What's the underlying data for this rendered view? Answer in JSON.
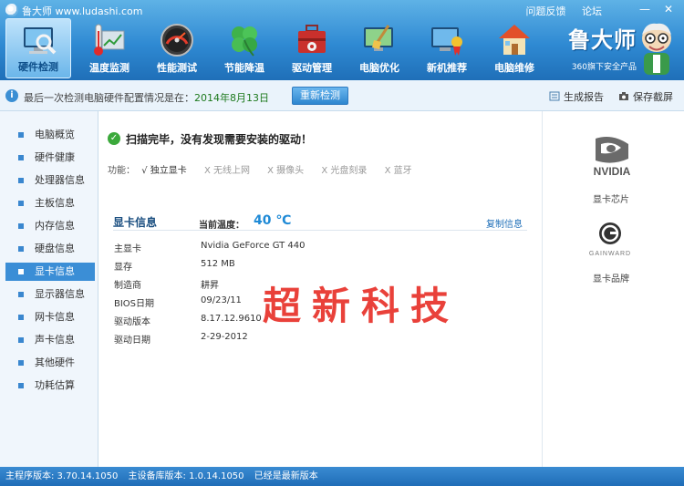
{
  "window": {
    "title": "鲁大师 www.ludashi.com",
    "links": [
      "问题反馈",
      "论坛"
    ],
    "controls": [
      "—",
      "✕"
    ]
  },
  "toolbar": [
    {
      "label": "硬件检测",
      "icon": "monitor-magnifier-icon",
      "active": true
    },
    {
      "label": "温度监测",
      "icon": "thermometer-icon",
      "active": false
    },
    {
      "label": "性能测试",
      "icon": "speedometer-icon",
      "active": false
    },
    {
      "label": "节能降温",
      "icon": "clover-leaf-icon",
      "active": false
    },
    {
      "label": "驱动管理",
      "icon": "toolbox-icon",
      "active": false
    },
    {
      "label": "电脑优化",
      "icon": "monitor-broom-icon",
      "active": false
    },
    {
      "label": "新机推荐",
      "icon": "monitor-award-icon",
      "active": false
    },
    {
      "label": "电脑维修",
      "icon": "house-repair-icon",
      "active": false
    }
  ],
  "brand": {
    "name": "鲁大师",
    "slogan": "360旗下安全产品"
  },
  "infobar": {
    "text": "最后一次检测电脑硬件配置情况是在：",
    "date": "2014年8月13日",
    "rescan": "重新检测",
    "report": "生成报告",
    "screenshot": "保存截屏"
  },
  "sidebar": {
    "items": [
      {
        "label": "电脑概览",
        "active": false
      },
      {
        "label": "硬件健康",
        "active": false
      },
      {
        "label": "处理器信息",
        "active": false
      },
      {
        "label": "主板信息",
        "active": false
      },
      {
        "label": "内存信息",
        "active": false
      },
      {
        "label": "硬盘信息",
        "active": false
      },
      {
        "label": "显卡信息",
        "active": true
      },
      {
        "label": "显示器信息",
        "active": false
      },
      {
        "label": "网卡信息",
        "active": false
      },
      {
        "label": "声卡信息",
        "active": false
      },
      {
        "label": "其他硬件",
        "active": false
      },
      {
        "label": "功耗估算",
        "active": false
      }
    ]
  },
  "main": {
    "scan_message": "扫描完毕，没有发现需要安装的驱动！",
    "functions_label": "功能：",
    "functions": [
      {
        "label": "√ 独立显卡",
        "enabled": true
      },
      {
        "label": "X 无线上网",
        "enabled": false
      },
      {
        "label": "X 摄像头",
        "enabled": false
      },
      {
        "label": "X 光盘刻录",
        "enabled": false
      },
      {
        "label": "X 蓝牙",
        "enabled": false
      }
    ],
    "section_title": "显卡信息",
    "temp_label": "当前温度：",
    "temp_value": "40 ℃",
    "copy_link": "复制信息",
    "rows": [
      {
        "label": "主显卡",
        "value": "Nvidia GeForce GT 440"
      },
      {
        "label": "显存",
        "value": "512 MB"
      },
      {
        "label": "制造商",
        "value": "耕昇"
      },
      {
        "label": "BIOS日期",
        "value": "09/23/11"
      },
      {
        "label": "驱动版本",
        "value": "8.17.12.9610"
      },
      {
        "label": "驱动日期",
        "value": "2-29-2012"
      }
    ],
    "watermark": "超新科技"
  },
  "right_panel": {
    "chip_logo_text": "NVIDIA",
    "chip_label": "显卡芯片",
    "brand_logo_text": "GAINWARD",
    "brand_label": "显卡品牌"
  },
  "statusbar": {
    "program_version": "主程序版本: 3.70.14.1050",
    "device_db_version": "主设备库版本: 1.0.14.1050",
    "status": "已经是最新版本"
  },
  "colors": {
    "header_blue": "#2f8ad3",
    "accent_blue": "#3b8ed6",
    "watermark_red": "#e8312a",
    "temp_blue": "#1f8ad6"
  }
}
